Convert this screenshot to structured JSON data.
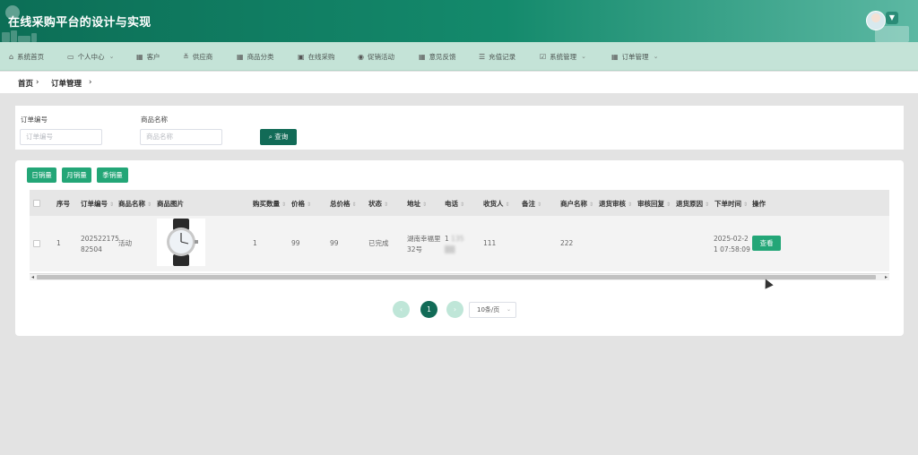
{
  "header": {
    "title": "在线采购平台的设计与实现"
  },
  "nav": [
    {
      "label": "系统首页",
      "icon": "home-icon",
      "glyph": "⌂",
      "chevron": false
    },
    {
      "label": "个人中心",
      "icon": "calendar-icon",
      "glyph": "▭",
      "chevron": true
    },
    {
      "label": "客户",
      "icon": "grid-icon",
      "glyph": "▦",
      "chevron": false
    },
    {
      "label": "供应商",
      "icon": "sliders-icon",
      "glyph": "≚",
      "chevron": false
    },
    {
      "label": "商品分类",
      "icon": "apps-icon",
      "glyph": "▦",
      "chevron": false
    },
    {
      "label": "在线采购",
      "icon": "clipboard-icon",
      "glyph": "▣",
      "chevron": false
    },
    {
      "label": "促销活动",
      "icon": "location-icon",
      "glyph": "◉",
      "chevron": false
    },
    {
      "label": "意见反馈",
      "icon": "apps-icon",
      "glyph": "▦",
      "chevron": false
    },
    {
      "label": "充值记录",
      "icon": "list-icon",
      "glyph": "☰",
      "chevron": false
    },
    {
      "label": "系统管理",
      "icon": "checkbox-icon",
      "glyph": "☑",
      "chevron": true
    },
    {
      "label": "订单管理",
      "icon": "apps-icon",
      "glyph": "▦",
      "chevron": true
    }
  ],
  "breadcrumb": {
    "home": "首页",
    "sep": "›",
    "current": "订单管理"
  },
  "search": {
    "order_no_label": "订单编号",
    "order_no_placeholder": "订单编号",
    "product_label": "商品名称",
    "product_placeholder": "商品名称",
    "query_label": "查询"
  },
  "actions": [
    "日销量",
    "月销量",
    "季销量"
  ],
  "table": {
    "headers": [
      "序号",
      "订单编号",
      "商品名称",
      "商品图片",
      "购买数量",
      "价格",
      "总价格",
      "状态",
      "地址",
      "电话",
      "收货人",
      "备注",
      "商户名称",
      "退货审核",
      "审核回复",
      "退货原因",
      "下单时间",
      "操作"
    ],
    "row": {
      "index": "1",
      "order_no_1": "202522175",
      "order_no_2": "82504",
      "product": "活动",
      "quantity": "1",
      "price": "99",
      "total": "99",
      "status": "已完成",
      "address_1": "湖南幸福里",
      "address_2": "32号",
      "phone_1": "1",
      "phone_2": "135",
      "receiver": "111",
      "merchant": "222",
      "time_1": "2025-02-2",
      "time_2": "1 07:58:09",
      "view_label": "查看"
    }
  },
  "pagination": {
    "prev": "‹",
    "current": "1",
    "next": "›",
    "page_size": "10条/页"
  },
  "colors": {
    "accent": "#126b57",
    "button": "#23a677",
    "nav_bg": "#c4e3d7"
  }
}
